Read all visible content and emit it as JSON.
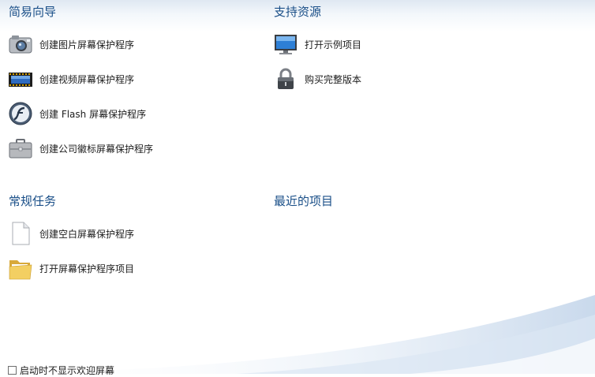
{
  "sections": {
    "wizard": {
      "title": "简易向导",
      "items": [
        {
          "label": "创建图片屏幕保护程序",
          "icon": "camera-icon"
        },
        {
          "label": "创建视频屏幕保护程序",
          "icon": "film-strip-icon"
        },
        {
          "label": "创建 Flash 屏幕保护程序",
          "icon": "flash-icon"
        },
        {
          "label": "创建公司徽标屏幕保护程序",
          "icon": "briefcase-icon"
        }
      ]
    },
    "resources": {
      "title": "支持资源",
      "items": [
        {
          "label": "打开示例项目",
          "icon": "monitor-icon"
        },
        {
          "label": "购买完整版本",
          "icon": "padlock-icon"
        }
      ]
    },
    "tasks": {
      "title": "常规任务",
      "items": [
        {
          "label": "创建空白屏幕保护程序",
          "icon": "blank-document-icon"
        },
        {
          "label": "打开屏幕保护程序项目",
          "icon": "folder-icon"
        }
      ]
    },
    "recent": {
      "title": "最近的项目",
      "items": []
    }
  },
  "footer": {
    "checkbox_label": "启动时不显示欢迎屏幕",
    "checked": false
  }
}
